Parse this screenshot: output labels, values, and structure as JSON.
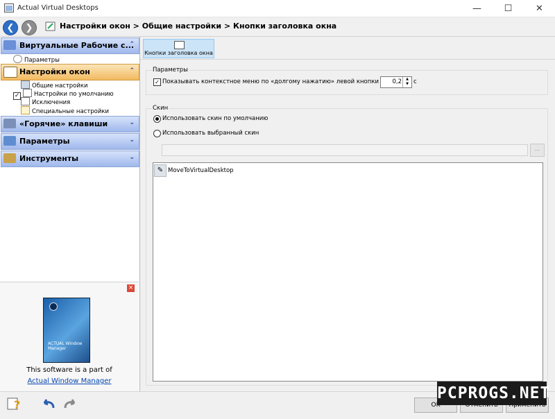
{
  "window": {
    "title": "Actual Virtual Desktops",
    "minimize": "—",
    "maximize": "☐",
    "close": "✕"
  },
  "nav": {
    "breadcrumb": "Настройки окон > Общие настройки > Кнопки заголовка окна"
  },
  "sidebar": {
    "sections": [
      {
        "label": "Виртуальные Рабочие с...",
        "chevron": "⌃",
        "items": [
          {
            "label": "Параметры"
          }
        ]
      },
      {
        "label": "Настройки окон",
        "chevron": "⌃",
        "items": [
          {
            "label": "Общие настройки"
          },
          {
            "label": "Настройки по умолчанию"
          },
          {
            "label": "Исключения"
          },
          {
            "label": "Специальные настройки"
          }
        ]
      },
      {
        "label": "«Горячие» клавиши",
        "chevron": "⌄"
      },
      {
        "label": "Параметры",
        "chevron": "⌄"
      },
      {
        "label": "Инструменты",
        "chevron": "⌄"
      }
    ]
  },
  "promo": {
    "close": "×",
    "box_text": "ACTUAL Window Manager",
    "text": "This software is a part of",
    "link": "Actual Window Manager"
  },
  "toolbar": {
    "button_label": "Кнопки заголовка окна"
  },
  "params_group": {
    "title": "Параметры",
    "checkbox_label": "Показывать контекстное меню по «долгому нажатию» левой кнопки мыши",
    "checkbox_checked": true,
    "checkbox_mark": "✓",
    "delay_value": "0,2",
    "delay_unit": "с"
  },
  "skin_group": {
    "title": "Скин",
    "radio_default": "Использовать скин по умолчанию",
    "radio_custom": "Использовать выбранный скин",
    "selected": "default",
    "path_value": "",
    "browse_label": "...",
    "list_items": [
      {
        "label": "MoveToVirtualDesktop"
      }
    ]
  },
  "footer": {
    "ok": "OK",
    "cancel": "Отменить",
    "apply": "Применить"
  },
  "watermark": "PCPROGS.NET"
}
